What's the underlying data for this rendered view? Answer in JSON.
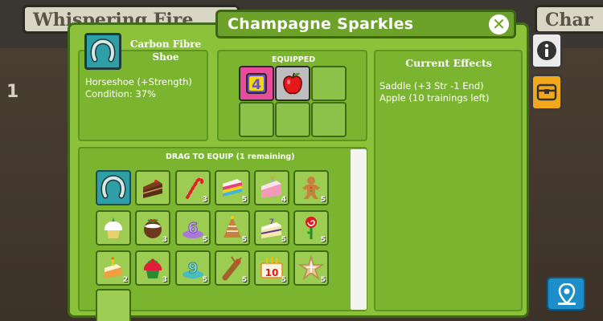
{
  "background": {
    "tab_left": "Whispering Fire",
    "tab_right": "Char",
    "row_number": "1",
    "map_icon": "map-pin-icon"
  },
  "dialog": {
    "title": "Champagne Sparkles",
    "close_icon": "close-icon"
  },
  "item": {
    "icon": "horseshoe-icon",
    "name": "Carbon Fibre Shoe",
    "type": "Horseshoe (+Strength)",
    "condition": "Condition: 37%"
  },
  "equipped": {
    "label": "EQUIPPED",
    "slots": [
      {
        "icon": "saddle-icon",
        "value": "4"
      },
      {
        "icon": "apple-icon"
      },
      {
        "icon": ""
      },
      {
        "icon": ""
      },
      {
        "icon": ""
      },
      {
        "icon": ""
      }
    ]
  },
  "effects": {
    "title": "Current Effects",
    "lines": [
      "Saddle (+3 Str -1 End)",
      "Apple (10 trainings left)"
    ]
  },
  "inventory": {
    "label": "DRAG TO EQUIP (1 remaining)",
    "items": [
      {
        "icon": "horseshoe-icon",
        "qty": ""
      },
      {
        "icon": "chocolate-cake-icon",
        "qty": ""
      },
      {
        "icon": "candy-cane-icon",
        "qty": "3"
      },
      {
        "icon": "rainbow-cake-icon",
        "qty": "5"
      },
      {
        "icon": "birthday-cake-slice-icon",
        "qty": "4"
      },
      {
        "icon": "gingerbread-man-icon",
        "qty": "5"
      },
      {
        "icon": "cupcake-icon",
        "qty": ""
      },
      {
        "icon": "christmas-pudding-icon",
        "qty": "3"
      },
      {
        "icon": "number-6-cake-icon",
        "qty": "5"
      },
      {
        "icon": "gingerbread-tree-icon",
        "qty": "5"
      },
      {
        "icon": "number-7-cake-slice-icon",
        "qty": "5"
      },
      {
        "icon": "lollipop-flower-icon",
        "qty": "5"
      },
      {
        "icon": "candle-cake-slice-icon",
        "qty": "2"
      },
      {
        "icon": "holly-cupcake-icon",
        "qty": "3"
      },
      {
        "icon": "number-9-cake-icon",
        "qty": "5"
      },
      {
        "icon": "gingerbread-reindeer-icon",
        "qty": "5"
      },
      {
        "icon": "number-10-cake-icon",
        "qty": "5"
      },
      {
        "icon": "star-cookie-icon",
        "qty": "5"
      },
      {
        "icon": "",
        "qty": ""
      }
    ]
  },
  "side_tabs": [
    {
      "icon": "info-icon"
    },
    {
      "icon": "treasure-chest-icon"
    }
  ],
  "colors": {
    "panel_green": "#8bc23a",
    "dark_green": "#3f6b16",
    "selected_teal": "#2e9fa6",
    "chest_orange": "#f2a81a"
  }
}
